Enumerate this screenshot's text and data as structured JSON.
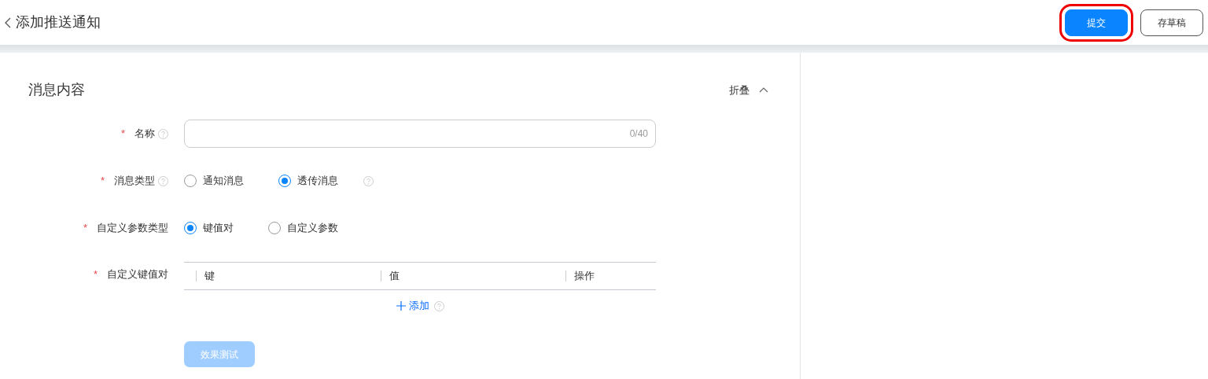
{
  "header": {
    "title": "添加推送通知",
    "buttons": [
      {
        "label": "提交",
        "kind": "primary",
        "highlighted": true
      },
      {
        "label": "存草稿",
        "kind": "outline",
        "highlighted": false
      }
    ]
  },
  "section": {
    "title": "消息内容",
    "toggle": {
      "label": "折叠",
      "expanded": true
    }
  },
  "fields": [
    {
      "kind": "text",
      "label": "名称",
      "required_mark": "*",
      "help": true,
      "counter": "0/40"
    },
    {
      "kind": "radio",
      "label": "消息类型",
      "required_mark": "*",
      "help": true,
      "options": [
        {
          "label": "通知消息",
          "selected": false
        },
        {
          "label": "透传消息",
          "selected": true
        }
      ],
      "trailing_help": true
    },
    {
      "kind": "radio",
      "label": "自定义参数类型",
      "required_mark": "*",
      "help": false,
      "options": [
        {
          "label": "键值对",
          "selected": true
        },
        {
          "label": "自定义参数",
          "selected": false
        }
      ],
      "trailing_help": false
    },
    {
      "kind": "table",
      "label": "自定义键值对",
      "required_mark": "*",
      "help": false,
      "columns": [
        "键",
        "值",
        "操作"
      ],
      "add_label": "添加"
    }
  ],
  "test_button": {
    "label": "效果测试",
    "disabled": true
  }
}
